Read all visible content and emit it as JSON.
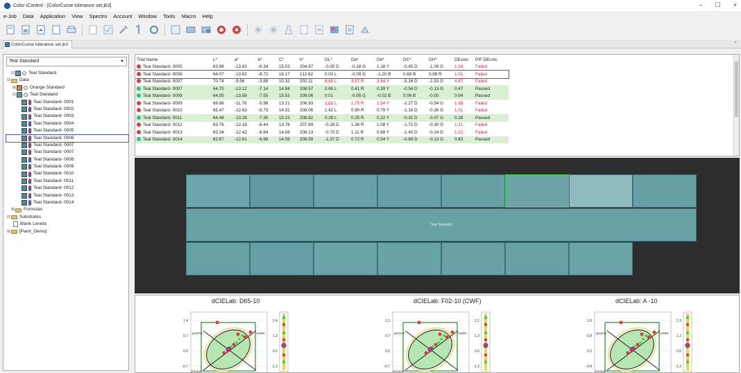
{
  "window": {
    "title": "Color iControl - [ColorCurve tolerance set.jk3]",
    "minimize": "–",
    "maximize": "☐",
    "close": "×"
  },
  "menu": [
    "e-Job",
    "Data",
    "Application",
    "View",
    "Spectro",
    "Account",
    "Window",
    "Tools",
    "Macro",
    "Help"
  ],
  "tab": {
    "label": "ColorCurve tolerance set.jk3",
    "close": "×"
  },
  "left_panel": {
    "dropdown": "Teal Standard",
    "tree": {
      "root_standard": "Teal Standard",
      "data": "Data",
      "orange": "Orange Standard",
      "teal": "Teal Standard",
      "samples": [
        "Teal Standard- 0001",
        "Teal Standard- 0002",
        "Teal Standard- 0003",
        "Teal Standard- 0004",
        "Teal Standard- 0005",
        "Teal Standard- 0006",
        "Teal Standard- 0007",
        "Teal Standard- 0007",
        "Teal Standard- 0008",
        "Teal Standard- 0009",
        "Teal Standard- 0010",
        "Teal Standard- 0011",
        "Teal Standard- 0012",
        "Teal Standard- 0013",
        "Teal Standard- 0014"
      ],
      "formulas": "Formulas",
      "substrates": "Substrates",
      "blank": "Blank Leneta",
      "paint": "[Paint_Demo]"
    }
  },
  "table": {
    "headers": [
      "Trial Name",
      "L*",
      "a*",
      "b*",
      "C*",
      "h°",
      "DL*",
      "Da*",
      "Db*",
      "DC*",
      "DH*",
      "DEcmc",
      "P/F DEcmc"
    ],
    "rows": [
      {
        "name": "Teal Standard- 0005",
        "L": "63.99",
        "a": "-13.63",
        "b": "-6.34",
        "C": "15.03",
        "h": "204.97",
        "DL": "-0.05 D",
        "Da": "-0.18 G",
        "Db": "1.18 Y",
        "DC": "-0.45 D",
        "DH": "-1.09 G",
        "DE": "1.04",
        "PF": "Failed",
        "status": "failed"
      },
      {
        "name": "Teal Standard- 0006",
        "L": "64.07",
        "a": "-13.62",
        "b": "-8.72",
        "C": "16.17",
        "h": "212.62",
        "DL": "0.02 L",
        "Da": "-0.09 G",
        "Db": "-1.20 B",
        "DC": "0.69 B",
        "DH": "0.98 R",
        "DE": "1.01",
        "PF": "Failed",
        "status": "failed"
      },
      {
        "name": "Teal Standard- 0007",
        "L": "70.74",
        "a": "-9.56",
        "b": "-3.88",
        "C": "10.32",
        "h": "202.11",
        "DL": "6.69 L",
        "Da": "3.97 R",
        "Db": "3.64 Y",
        "DC": "-5.16 D",
        "DH": "-1.53 G",
        "DE": "4.67",
        "PF": "Failed",
        "status": "failed"
      },
      {
        "name": "Teal Standard- 0007",
        "L": "64.70",
        "a": "-13.12",
        "b": "-7.14",
        "C": "14.94",
        "h": "208.57",
        "DL": "0.65 L",
        "Da": "0.41 R",
        "Db": "0.39 Y",
        "DC": "-0.54 D",
        "DH": "-0.13 G",
        "DE": "0.47",
        "PF": "Passed",
        "status": "passed"
      },
      {
        "name": "Teal Standard- 0008",
        "L": "64.05",
        "a": "-13.58",
        "b": "-7.55",
        "C": "15.53",
        "h": "209.06",
        "DL": "0.01",
        "Da": "-0.05 G",
        "Db": "-0.02 B",
        "DC": "0.06 B",
        "DH": "-0.00",
        "DE": "0.04",
        "PF": "Passed",
        "status": "passed"
      },
      {
        "name": "Teal Standard- 0009",
        "L": "66.86",
        "a": "-11.78",
        "b": "-5.98",
        "C": "13.21",
        "h": "206.93",
        "DL": "2.81 L",
        "Da": "1.75 R",
        "Db": "1.54 Y",
        "DC": "-2.27 D",
        "DH": "-0.54 G",
        "DE": "1.99",
        "PF": "Failed",
        "status": "failed"
      },
      {
        "name": "Teal Standard- 0010",
        "L": "65.47",
        "a": "-12.63",
        "b": "-6.73",
        "C": "14.31",
        "h": "208.06",
        "DL": "1.42 L",
        "Da": "0.90 R",
        "Db": "0.79 Y",
        "DC": "-1.16 D",
        "DH": "-0.26 G",
        "DE": "1.01",
        "PF": "Failed",
        "status": "failed"
      },
      {
        "name": "Teal Standard- 0011",
        "L": "64.44",
        "a": "-13.28",
        "b": "-7.30",
        "C": "15.15",
        "h": "208.82",
        "DL": "0.39 L",
        "Da": "0.25 R",
        "Db": "0.22 Y",
        "DC": "-0.32 D",
        "DH": "-0.07 G",
        "DE": "0.28",
        "PF": "Passed",
        "status": "passed"
      },
      {
        "name": "Teal Standard- 0012",
        "L": "63.76",
        "a": "-12.16",
        "b": "-6.44",
        "C": "13.76",
        "h": "207.89",
        "DL": "-0.28 D",
        "Da": "1.36 R",
        "Db": "1.08 Y",
        "DC": "-1.72 D",
        "DH": "-0.30 G",
        "DE": "1.21",
        "PF": "Failed",
        "status": "failed"
      },
      {
        "name": "Teal Standard- 0013",
        "L": "63.34",
        "a": "-12.42",
        "b": "-6.64",
        "C": "14.08",
        "h": "208.13",
        "DL": "-0.70 D",
        "Da": "1.11 R",
        "Db": "0.88 Y",
        "DC": "-1.40 D",
        "DH": "-0.24 G",
        "DE": "1.02",
        "PF": "Failed",
        "status": "failed"
      },
      {
        "name": "Teal Standard- 0014",
        "L": "62.67",
        "a": "-12.81",
        "b": "-6.98",
        "C": "14.59",
        "h": "208.59",
        "DL": "-1.37 D",
        "Da": "0.72 R",
        "Db": "0.54 Y",
        "DC": "-0.89 D",
        "DH": "-0.13 G",
        "DE": "0.83",
        "PF": "Passed",
        "status": "passed"
      }
    ]
  },
  "swatches": {
    "center_label": "Teal Standard",
    "top_colors": [
      "#6aa6ab",
      "#5f9aa0",
      "#66a2a7",
      "#64a0a5",
      "#679fa4",
      "#6ea3a7",
      "#8fbcbe",
      "#689fa4"
    ],
    "bottom_colors": [
      "#66a1a6",
      "#64a0a5",
      "#6aa3a8",
      "#68a3a8",
      "#6ba1a6",
      "#66a1a6",
      "#6aa3a8"
    ],
    "center_color": "#68a2a7"
  },
  "plots": [
    {
      "title": "dCIELab: D65-10",
      "yticks": [
        "1.4",
        "0.7",
        "0.0",
        "-0.7"
      ],
      "sideticks": [
        "2.4",
        "1.2",
        "0.0",
        "-1.2"
      ],
      "labels": [
        "greener",
        "redder",
        "yellower",
        "bluer",
        "chroma"
      ]
    },
    {
      "title": "dCIELab: F02-10 (CWF)",
      "yticks": [
        "1.3",
        "0.7",
        "0.0",
        "-0.7"
      ],
      "sideticks": [
        "2.1",
        "1.2",
        "0.0",
        "-1.2"
      ],
      "labels": [
        "greener",
        "redder",
        "yellower",
        "bluer",
        "chroma"
      ]
    },
    {
      "title": "dCIELab: A -10",
      "yticks": [
        "1.6",
        "0.8",
        "0.0",
        "-0.8"
      ],
      "sideticks": [
        "2.3",
        "1.2",
        "0.0",
        "-1.2"
      ],
      "labels": [
        "greener",
        "redder",
        "yellower",
        "bluer",
        "chroma"
      ]
    }
  ],
  "colors": {
    "passed_bg": "#d9f0d3",
    "fail_text": "#dd2222",
    "selection": "#3c57c8",
    "teal": "#2fbf8f",
    "red_dot": "#e03a3a"
  }
}
